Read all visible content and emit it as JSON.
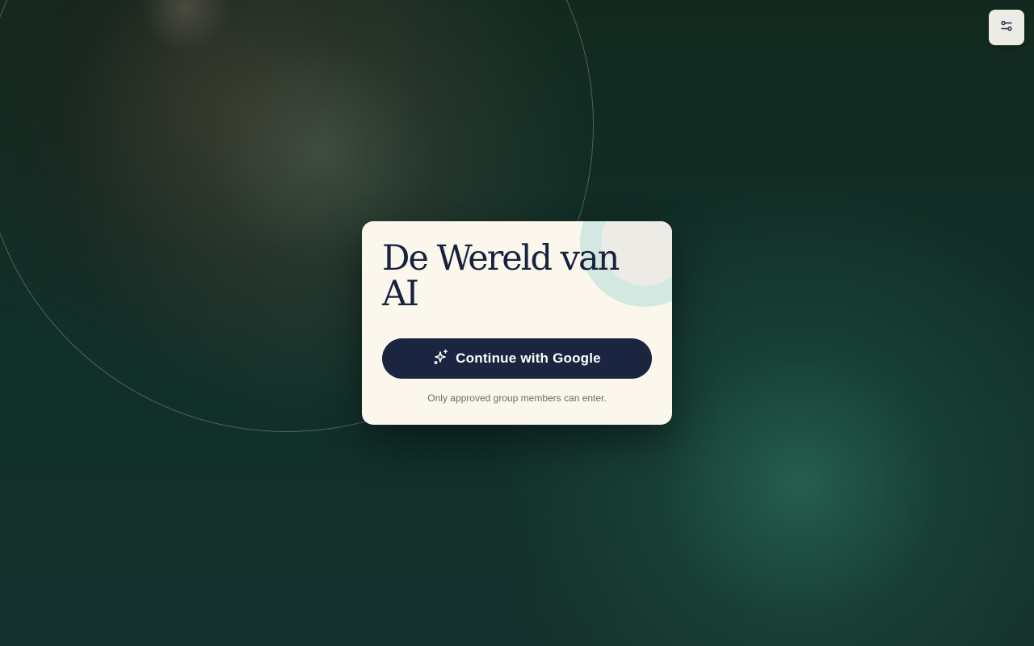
{
  "title": "De Wereld van AI",
  "sign_in_button": {
    "label": "Continue with Google",
    "icon": "sparkles-icon"
  },
  "note": "Only approved group members can enter.",
  "settings_button": {
    "icon": "sliders-icon"
  },
  "colors": {
    "card_background": "#fbf7ec",
    "title_text": "#16223e",
    "button_background": "#1b2540",
    "button_text": "#ffffff",
    "note_text": "#6b6a66",
    "deco_ring": "#d3e8e1",
    "page_background": "#0f2a24"
  }
}
